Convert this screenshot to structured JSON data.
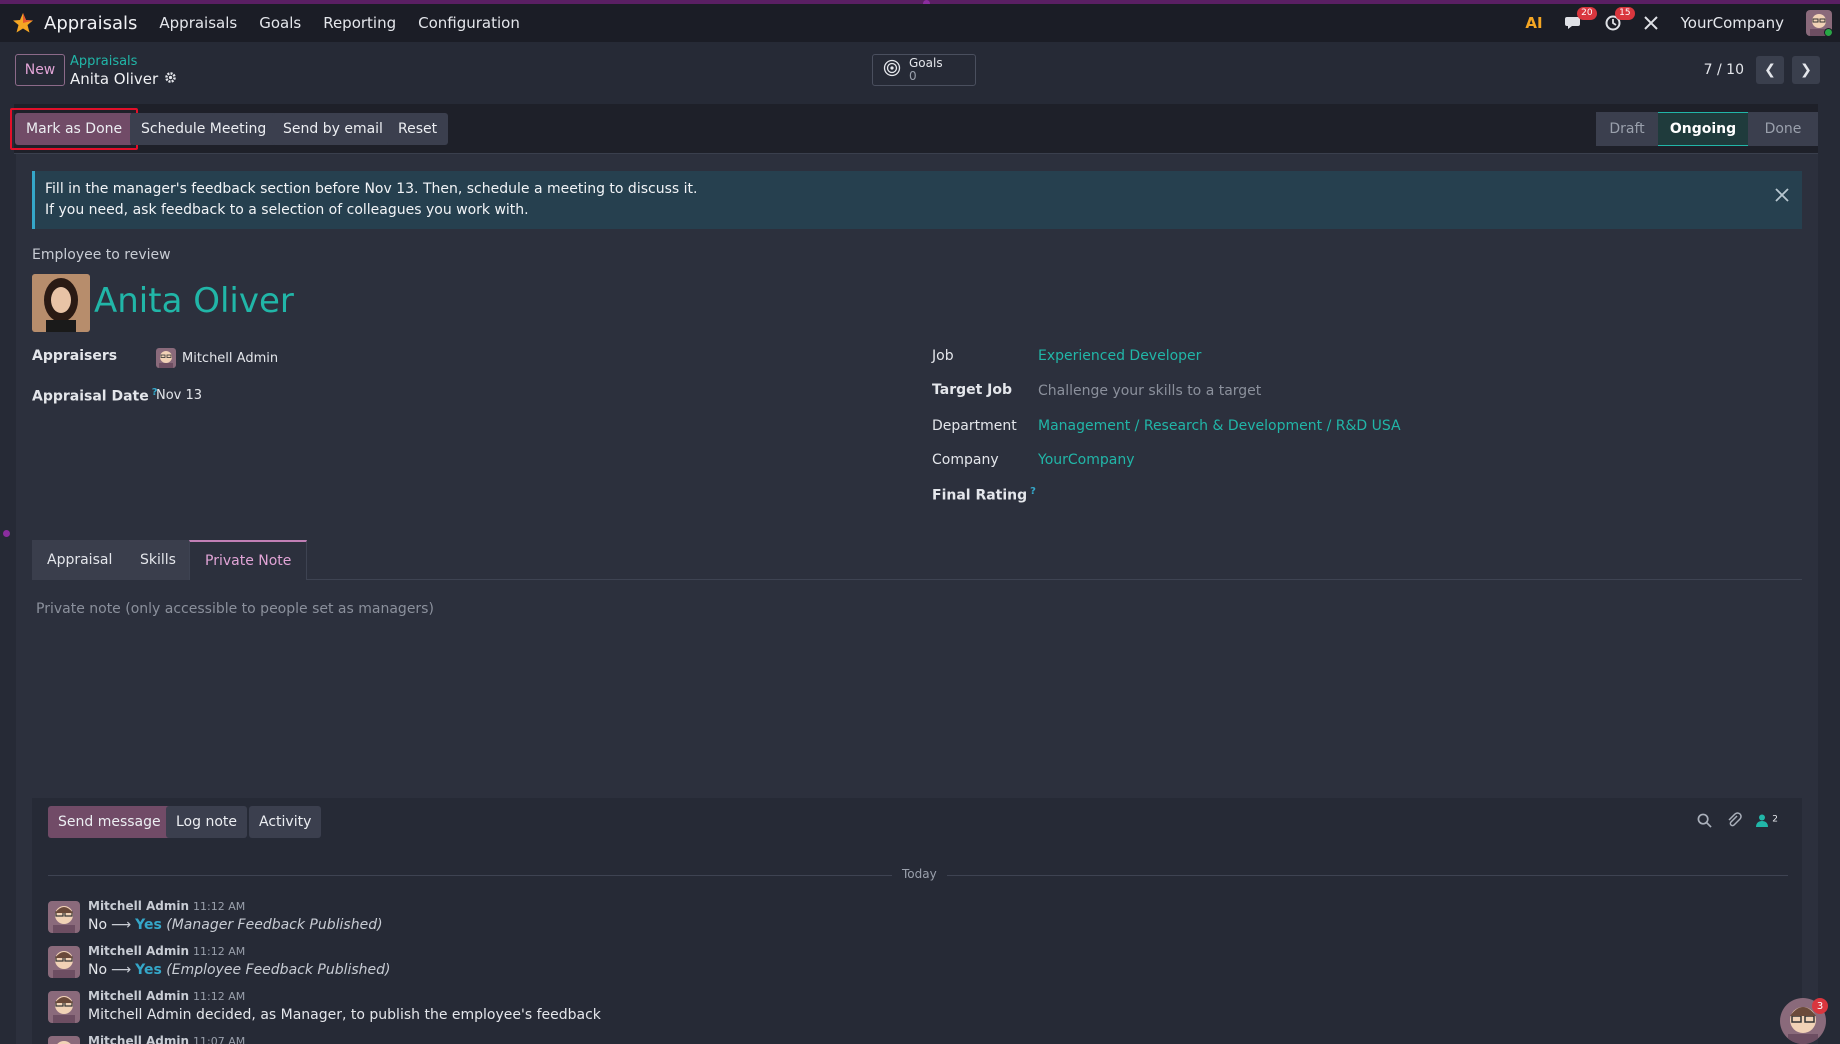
{
  "navbar": {
    "app_name": "Appraisals",
    "menu": [
      "Appraisals",
      "Goals",
      "Reporting",
      "Configuration"
    ],
    "messages_count": "20",
    "activities_count": "15",
    "company": "YourCompany"
  },
  "control": {
    "new_label": "New",
    "breadcrumb": "Appraisals",
    "record_name": "Anita Oliver",
    "goals_label": "Goals",
    "goals_count": "0",
    "pager": "7 / 10"
  },
  "statusbar": {
    "buttons": [
      "Mark as Done",
      "Schedule Meeting",
      "Send by email",
      "Reset"
    ],
    "stages": [
      "Draft",
      "Ongoing",
      "Done"
    ],
    "active_stage": "Ongoing"
  },
  "form": {
    "alert_line1": "Fill in the manager's feedback section before Nov 13. Then, schedule a meeting to discuss it.",
    "alert_line2": "If you need, ask feedback to a selection of colleagues you work with.",
    "employee_label": "Employee to review",
    "employee_name": "Anita Oliver",
    "appraisers_label": "Appraisers",
    "appraisers_value": "Mitchell Admin",
    "appraisal_date_label": "Appraisal Date",
    "appraisal_date_value": "Nov 13",
    "job_label": "Job",
    "job_value": "Experienced Developer",
    "target_job_label": "Target Job",
    "target_job_placeholder": "Challenge your skills to a target",
    "department_label": "Department",
    "department_value": "Management / Research & Development / R&D USA",
    "company_label": "Company",
    "company_value": "YourCompany",
    "final_rating_label": "Final Rating",
    "help_mark": "?"
  },
  "tabs": {
    "items": [
      "Appraisal",
      "Skills",
      "Private Note"
    ],
    "active": "Private Note",
    "note_placeholder": "Private note (only accessible to people set as managers)"
  },
  "chatter": {
    "buttons": [
      "Send message",
      "Log note",
      "Activity"
    ],
    "followers_count": "2",
    "date_separator": "Today",
    "messages": [
      {
        "author": "Mitchell Admin",
        "time": "11:12 AM",
        "old": "No",
        "new": "Yes",
        "field": "(Manager Feedback Published)"
      },
      {
        "author": "Mitchell Admin",
        "time": "11:12 AM",
        "old": "No",
        "new": "Yes",
        "field": "(Employee Feedback Published)"
      },
      {
        "author": "Mitchell Admin",
        "time": "11:12 AM",
        "text": "Mitchell Admin decided, as Manager, to publish the employee's feedback"
      },
      {
        "author": "Mitchell Admin",
        "time": "11:07 AM"
      }
    ],
    "bot_badge": "3"
  },
  "colors": {
    "accent_teal": "#21b6a8",
    "primary_purple": "#714b67",
    "highlight_red": "#e2102a"
  }
}
